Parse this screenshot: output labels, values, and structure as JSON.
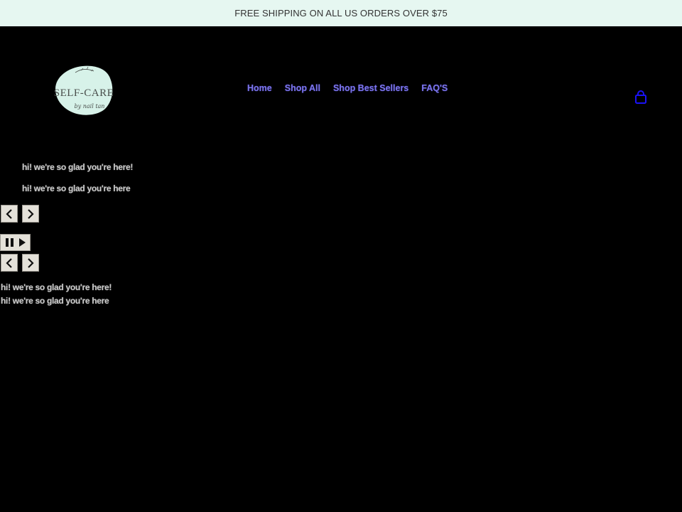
{
  "announcement": {
    "text": "FREE SHIPPING ON ALL US ORDERS OVER $75"
  },
  "logo": {
    "wordmark": "SELF-CARE",
    "script": "by nail tan",
    "badge_color": "#d7f2e9",
    "ink_color": "#4a4f4c"
  },
  "nav": {
    "items": [
      {
        "label": "Home"
      },
      {
        "label": "Shop All"
      },
      {
        "label": "Shop Best Sellers"
      },
      {
        "label": "FAQ'S"
      }
    ],
    "link_color": "#7b74e8"
  },
  "cart": {
    "icon": "cart-icon",
    "color": "#1a12f5"
  },
  "slideshow_primary": {
    "slides": [
      {
        "text": "hi! we're so glad you're here!"
      },
      {
        "text": "hi! we're so glad you're here"
      }
    ],
    "prev_icon": "chevron-left-icon",
    "next_icon": "chevron-right-icon"
  },
  "slideshow_controls": {
    "pause_icon": "pause-icon",
    "play_icon": "play-icon"
  },
  "slideshow_secondary": {
    "slides": [
      {
        "text": "hi! we're so glad you're here!"
      },
      {
        "text": "hi! we're so glad you're here"
      }
    ],
    "prev_icon": "chevron-left-icon",
    "next_icon": "chevron-right-icon"
  }
}
